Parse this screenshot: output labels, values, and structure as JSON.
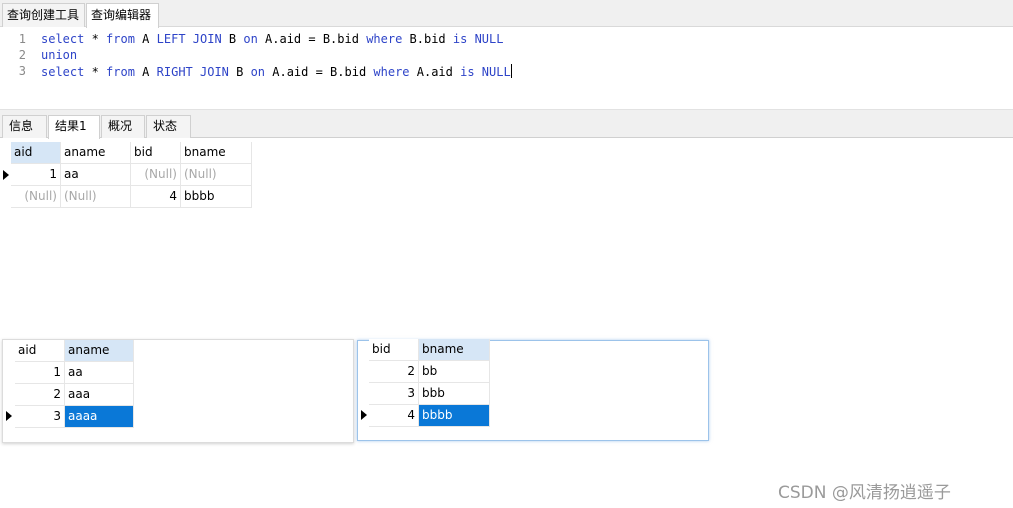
{
  "top_tabs": [
    {
      "label": "查询创建工具",
      "active": false
    },
    {
      "label": "查询编辑器",
      "active": true
    }
  ],
  "editor": {
    "line_numbers": [
      "1",
      "2",
      "3"
    ],
    "lines": [
      [
        "select",
        " * ",
        "from",
        " A ",
        "LEFT JOIN",
        " B ",
        "on",
        " A.aid = B.bid ",
        "where",
        " B.bid ",
        "is",
        " ",
        "NULL"
      ],
      [
        "union"
      ],
      [
        "select",
        " * ",
        "from",
        " A ",
        "RIGHT JOIN",
        " B ",
        "on",
        " A.aid = B.bid ",
        "where",
        " A.aid ",
        "is",
        " ",
        "NULL"
      ]
    ],
    "keyword_color": "#2e44c8"
  },
  "result_tabs": [
    {
      "label": "信息",
      "active": false
    },
    {
      "label": "结果1",
      "active": true
    },
    {
      "label": "概况",
      "active": false
    },
    {
      "label": "状态",
      "active": false
    }
  ],
  "result_grid": {
    "columns": [
      "aid",
      "aname",
      "bid",
      "bname"
    ],
    "rows": [
      [
        "1",
        "aa",
        "(Null)",
        "(Null)"
      ],
      [
        "(Null)",
        "(Null)",
        "4",
        "bbbb"
      ]
    ]
  },
  "table_a": {
    "columns": [
      "aid",
      "aname"
    ],
    "rows": [
      [
        "1",
        "aa"
      ],
      [
        "2",
        "aaa"
      ],
      [
        "3",
        "aaaa"
      ]
    ]
  },
  "table_b": {
    "columns": [
      "bid",
      "bname"
    ],
    "rows": [
      [
        "2",
        "bb"
      ],
      [
        "3",
        "bbb"
      ],
      [
        "4",
        "bbbb"
      ]
    ]
  },
  "selection_color": "#0a78d7",
  "watermark": "CSDN @风清扬逍遥子"
}
